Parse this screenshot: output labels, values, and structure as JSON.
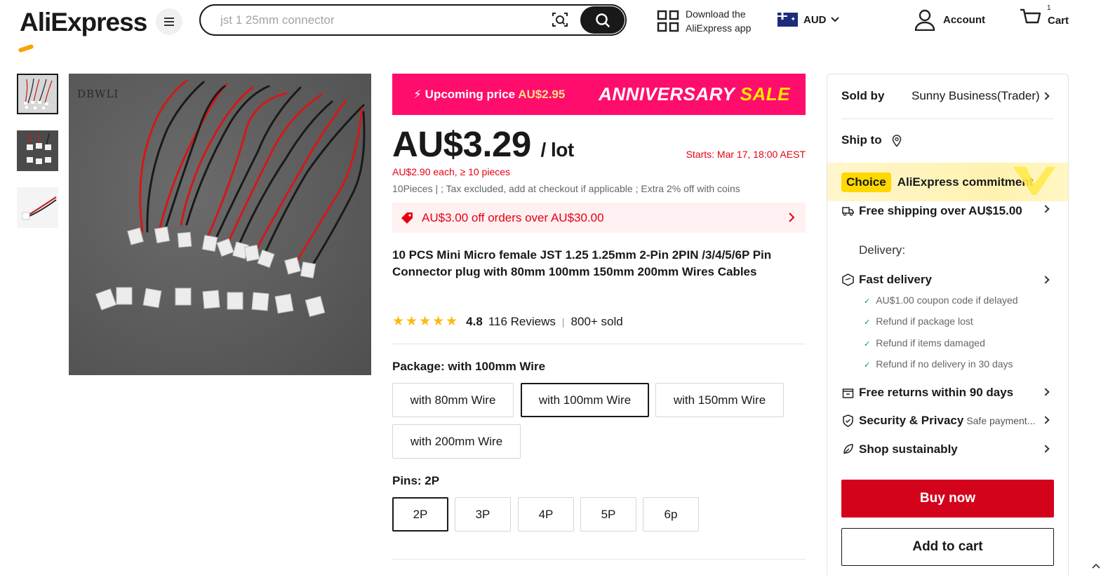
{
  "header": {
    "logo": "AliExpress",
    "search": {
      "placeholder": "jst 1 25mm connector"
    },
    "download_line1": "Download the",
    "download_line2": "AliExpress app",
    "currency": "AUD",
    "account": "Account",
    "cart": "Cart",
    "cart_count": "1"
  },
  "gallery": {
    "watermark": "DBWLI"
  },
  "promo": {
    "upcoming_label": "Upcoming price",
    "upcoming_price": "AU$2.95",
    "anniversary": "ANNIVERSARY",
    "sale": "SALE"
  },
  "product": {
    "price": "AU$3.29",
    "per": "/ lot",
    "starts": "Starts:  Mar 17, 18:00 AEST",
    "bulk": "AU$2.90 each, ≥ 10 pieces",
    "tax": "10Pieces | ; Tax excluded, add at checkout if applicable ; Extra 2% off with coins",
    "coupon": "AU$3.00 off orders over AU$30.00",
    "title": "10 PCS Mini Micro female JST 1.25 1.25mm 2-Pin 2PIN /3/4/5/6P Pin Connector plug with 80mm 100mm 150mm 200mm Wires Cables",
    "rating": "4.8",
    "reviews": "116 Reviews",
    "sold": "800+ sold",
    "stars": "★★★★★"
  },
  "package": {
    "label": "Package: with 100mm Wire",
    "options": [
      "with 80mm Wire",
      "with 100mm Wire",
      "with 150mm Wire",
      "with 200mm Wire"
    ],
    "selected": "with 100mm Wire"
  },
  "pins": {
    "label": "Pins: 2P",
    "options": [
      "2P",
      "3P",
      "4P",
      "5P",
      "6p"
    ],
    "selected": "2P"
  },
  "panel": {
    "sold_by_label": "Sold by",
    "seller": "Sunny Business(Trader)",
    "ship_to_label": "Ship to",
    "choice_badge": "Choice",
    "commitment": "AliExpress commitment",
    "free_shipping": "Free shipping over AU$15.00",
    "delivery_label": "Delivery:",
    "fast_delivery": "Fast delivery",
    "fast_subs": [
      "AU$1.00 coupon code if delayed",
      "Refund if package lost",
      "Refund if items damaged",
      "Refund if no delivery in 30 days"
    ],
    "free_returns": "Free returns within 90 days",
    "security": "Security & Privacy",
    "security_sub": "Safe payment...",
    "sustainably": "Shop sustainably",
    "buy_now": "Buy now",
    "add_to_cart": "Add to cart"
  },
  "colors": {
    "brand_red": "#d3031c",
    "promo_pink": "#ff0d6c",
    "price_red": "#e60012",
    "star_yellow": "#fdb913",
    "choice_yellow": "#ffd800"
  }
}
